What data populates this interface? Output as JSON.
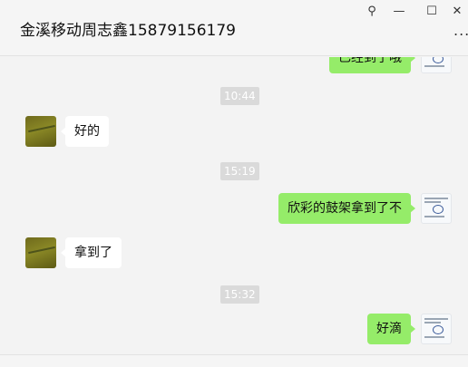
{
  "window": {
    "title": "金溪移动周志鑫15879156179",
    "pin_icon": "pin-icon",
    "minimize_icon": "minimize-icon",
    "maximize_icon": "maximize-icon",
    "close_icon": "close-icon",
    "more_icon": "more-icon",
    "pin_glyph": "⚲",
    "minimize_glyph": "—",
    "maximize_glyph": "☐",
    "close_glyph": "✕",
    "more_glyph": "..."
  },
  "chat": {
    "messages": [
      {
        "side": "right",
        "text": "已经到了哦"
      },
      {
        "type": "time",
        "text": "10:44"
      },
      {
        "side": "left",
        "text": "好的"
      },
      {
        "type": "time",
        "text": "15:19"
      },
      {
        "side": "right",
        "text": "欣彩的鼓架拿到了不"
      },
      {
        "side": "left",
        "text": "拿到了"
      },
      {
        "type": "time",
        "text": "15:32"
      },
      {
        "side": "right",
        "text": "好滴"
      }
    ]
  },
  "colors": {
    "sent_bubble": "#95ec69",
    "received_bubble": "#ffffff",
    "background": "#f3f3f3",
    "time_badge": "#dadada"
  }
}
